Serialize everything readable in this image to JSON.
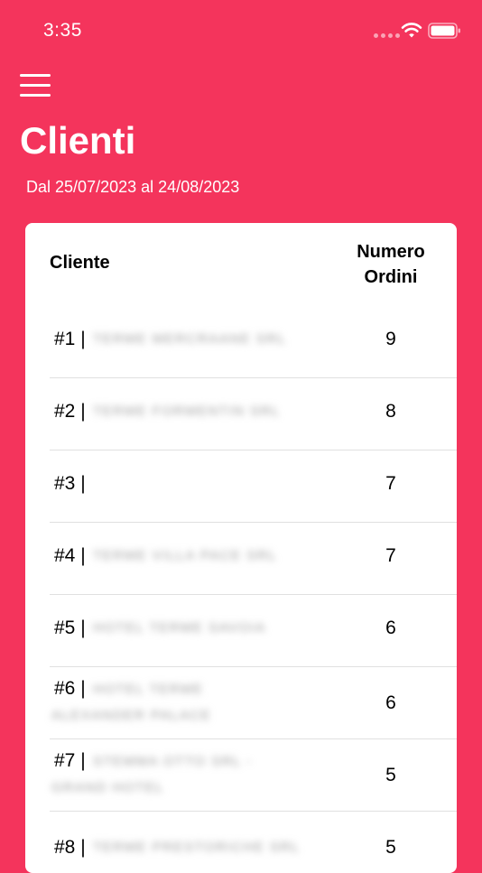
{
  "status_bar": {
    "time": "3:35"
  },
  "header": {
    "title": "Clienti",
    "date_range": {
      "prefix": "Dal",
      "from": "25/07/2023",
      "middle": "al",
      "to": "24/08/2023"
    }
  },
  "table": {
    "columns": {
      "cliente": "Cliente",
      "ordini_line1": "Numero",
      "ordini_line2": "Ordini"
    },
    "rows": [
      {
        "rank": "#1 |",
        "name": "TERME MERCRAANE SRL",
        "name2": "",
        "orders": "9"
      },
      {
        "rank": "#2 |",
        "name": "TERME FORMENTIN SRL",
        "name2": "",
        "orders": "8"
      },
      {
        "rank": "#3 |",
        "name": "",
        "name2": "",
        "orders": "7"
      },
      {
        "rank": "#4 |",
        "name": "TERME VILLA PACE SRL",
        "name2": "",
        "orders": "7"
      },
      {
        "rank": "#5 |",
        "name": "HOTEL TERME SAVOIA",
        "name2": "",
        "orders": "6"
      },
      {
        "rank": "#6 |",
        "name": "HOTEL TERME",
        "name2": "ALEXANDER PALACE",
        "orders": "6"
      },
      {
        "rank": "#7 |",
        "name": "STEMMA OTTO SRL -",
        "name2": "GRAND HOTEL",
        "orders": "5"
      },
      {
        "rank": "#8 |",
        "name": "TERME PRESTORICHE SRL",
        "name2": "",
        "orders": "5"
      }
    ]
  },
  "colors": {
    "background": "#f4345c",
    "card": "#ffffff",
    "text": "#000000"
  },
  "icons": {
    "menu": "hamburger-menu-icon",
    "wifi": "wifi-icon",
    "battery": "battery-icon"
  }
}
